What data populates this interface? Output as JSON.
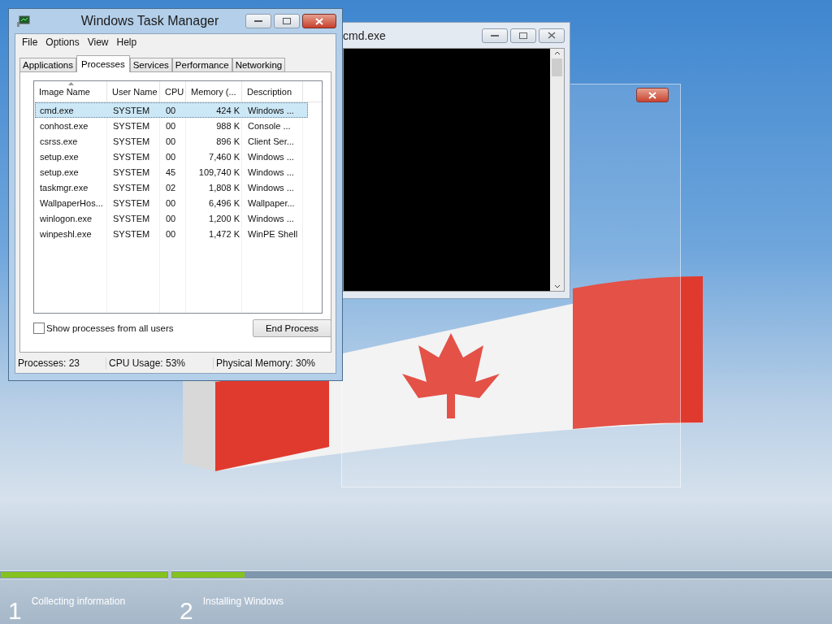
{
  "task_manager": {
    "title": "Windows Task Manager",
    "menu": [
      "File",
      "Options",
      "View",
      "Help"
    ],
    "tabs": [
      {
        "label": "Applications",
        "selected": false
      },
      {
        "label": "Processes",
        "selected": true
      },
      {
        "label": "Services",
        "selected": false
      },
      {
        "label": "Performance",
        "selected": false
      },
      {
        "label": "Networking",
        "selected": false
      }
    ],
    "columns": [
      {
        "label": "Image Name",
        "kind": "text",
        "sorted": true
      },
      {
        "label": "User Name",
        "kind": "text",
        "sorted": false
      },
      {
        "label": "CPU",
        "kind": "text",
        "sorted": false
      },
      {
        "label": "Memory (...",
        "kind": "number",
        "sorted": false
      },
      {
        "label": "Description",
        "kind": "text",
        "sorted": false
      }
    ],
    "rows": [
      {
        "cells": [
          "cmd.exe",
          "SYSTEM",
          "00",
          "424 K",
          "Windows ..."
        ],
        "selected": true
      },
      {
        "cells": [
          "conhost.exe",
          "SYSTEM",
          "00",
          "988 K",
          "Console ..."
        ],
        "selected": false
      },
      {
        "cells": [
          "csrss.exe",
          "SYSTEM",
          "00",
          "896 K",
          "Client Ser..."
        ],
        "selected": false
      },
      {
        "cells": [
          "setup.exe",
          "SYSTEM",
          "00",
          "7,460 K",
          "Windows ..."
        ],
        "selected": false
      },
      {
        "cells": [
          "setup.exe",
          "SYSTEM",
          "45",
          "109,740 K",
          "Windows ..."
        ],
        "selected": false
      },
      {
        "cells": [
          "taskmgr.exe",
          "SYSTEM",
          "02",
          "1,808 K",
          "Windows ..."
        ],
        "selected": false
      },
      {
        "cells": [
          "WallpaperHos...",
          "SYSTEM",
          "00",
          "6,496 K",
          "Wallpaper..."
        ],
        "selected": false
      },
      {
        "cells": [
          "winlogon.exe",
          "SYSTEM",
          "00",
          "1,200 K",
          "Windows ..."
        ],
        "selected": false
      },
      {
        "cells": [
          "winpeshl.exe",
          "SYSTEM",
          "00",
          "1,472 K",
          "WinPE Shell"
        ],
        "selected": false
      }
    ],
    "show_all_users": {
      "label": "Show processes from all users",
      "checked": false
    },
    "end_process_button": "End Process",
    "status_bar": [
      "Processes: 23",
      "CPU Usage: 53%",
      "Physical Memory: 30%"
    ]
  },
  "cmd_window": {
    "title": "cmd.exe"
  },
  "setup_steps": [
    {
      "number": "1",
      "label": "Collecting information",
      "level": 1
    },
    {
      "number": "2",
      "label": "Installing Windows",
      "level": 0.11
    }
  ]
}
